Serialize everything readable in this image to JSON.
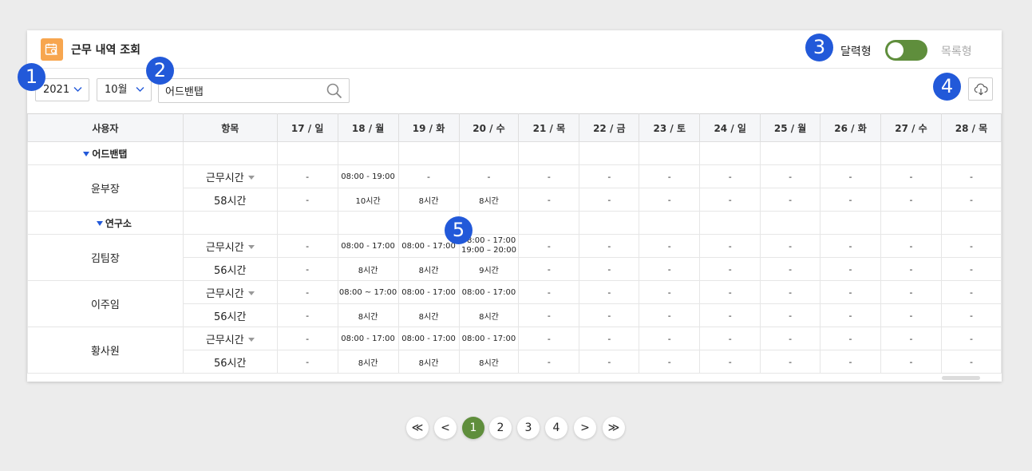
{
  "header": {
    "title": "근무 내역 조회",
    "view_calendar": "달력형",
    "view_list": "목록형"
  },
  "filters": {
    "year": "2021",
    "month": "10월",
    "search_value": "어드밴탭"
  },
  "badges": [
    "1",
    "2",
    "3",
    "4",
    "5"
  ],
  "table": {
    "columns": [
      "사용자",
      "항목",
      "17 / 일",
      "18 / 월",
      "19 / 화",
      "20 / 수",
      "21 / 목",
      "22 / 금",
      "23 / 토",
      "24 / 일",
      "25 / 월",
      "26 / 화",
      "27 / 수",
      "28 / 목"
    ],
    "dash": "-",
    "groups": {
      "company": "어드밴탭",
      "dept": "연구소"
    },
    "users": [
      {
        "name": "윤부장",
        "work_label": "근무시간",
        "total": "58시간",
        "times": [
          "-",
          "08:00 - 19:00",
          "-",
          "-",
          "-",
          "-",
          "-",
          "-",
          "-",
          "-",
          "-",
          "-"
        ],
        "hours": [
          "-",
          "10시간",
          "8시간",
          "8시간",
          "-",
          "-",
          "-",
          "-",
          "-",
          "-",
          "-",
          "-"
        ]
      },
      {
        "name": "김팀장",
        "work_label": "근무시간",
        "total": "56시간",
        "times": [
          "-",
          "08:00 - 17:00",
          "08:00 - 17:00",
          "08:00 - 17:00",
          "-",
          "-",
          "-",
          "-",
          "-",
          "-",
          "-",
          "-"
        ],
        "times_extra": "19:00 – 20:00",
        "hours": [
          "-",
          "8시간",
          "8시간",
          "9시간",
          "-",
          "-",
          "-",
          "-",
          "-",
          "-",
          "-",
          "-"
        ]
      },
      {
        "name": "이주임",
        "work_label": "근무시간",
        "total": "56시간",
        "times": [
          "-",
          "08:00 ~ 17:00",
          "08:00 - 17:00",
          "08:00 - 17:00",
          "-",
          "-",
          "-",
          "-",
          "-",
          "-",
          "-",
          "-"
        ],
        "hours": [
          "-",
          "8시간",
          "8시간",
          "8시간",
          "-",
          "-",
          "-",
          "-",
          "-",
          "-",
          "-",
          "-"
        ]
      },
      {
        "name": "황사원",
        "work_label": "근무시간",
        "total": "56시간",
        "times": [
          "-",
          "08:00 - 17:00",
          "08:00 - 17:00",
          "08:00 - 17:00",
          "-",
          "-",
          "-",
          "-",
          "-",
          "-",
          "-",
          "-"
        ],
        "hours": [
          "-",
          "8시간",
          "8시간",
          "8시간",
          "-",
          "-",
          "-",
          "-",
          "-",
          "-",
          "-",
          "-"
        ]
      }
    ]
  },
  "pagination": {
    "first": "≪",
    "prev": "<",
    "pages": [
      "1",
      "2",
      "3",
      "4"
    ],
    "next": ">",
    "last": "≫",
    "current": "1"
  },
  "colors": {
    "accent_green": "#5f8e3c",
    "badge_blue": "#2259d9",
    "icon_orange": "#f7a64f",
    "weekend_hours_purple": "#b45fd7"
  },
  "icons": [
    "calendar-search-icon",
    "chevron-down-icon",
    "search-icon",
    "cloud-download-icon",
    "triangle-down-icon"
  ]
}
